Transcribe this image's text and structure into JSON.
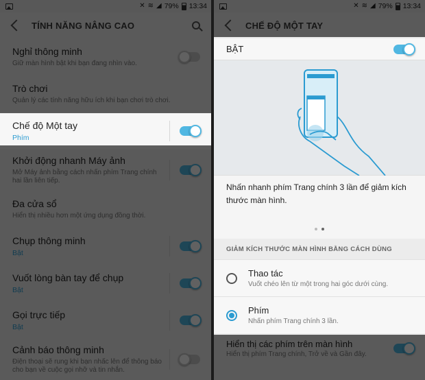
{
  "status": {
    "battery": "79%",
    "time": "13:34"
  },
  "left": {
    "title": "TÍNH NĂNG NÂNG CAO",
    "settings": [
      {
        "title": "Nghỉ thông minh",
        "sub": "Giữ màn hình bật khi bạn đang nhìn vào.",
        "on": false
      },
      {
        "title": "Trò chơi",
        "sub": "Quản lý các tính năng hữu ích khi bạn chơi trò chơi."
      },
      {
        "title": "Chế độ Một tay",
        "sub": "Phím",
        "on": true,
        "highlighted": true
      },
      {
        "title": "Khởi động nhanh Máy ảnh",
        "sub": "Mở Máy ảnh bằng cách nhấn phím Trang chính hai lần liên tiếp.",
        "on": true
      },
      {
        "title": "Đa cửa sổ",
        "sub": "Hiển thị nhiều hơn một ứng dụng đồng thời."
      },
      {
        "title": "Chụp thông minh",
        "sub": "Bật",
        "on": true
      },
      {
        "title": "Vuốt lòng bàn tay để chụp",
        "sub": "Bật",
        "on": true
      },
      {
        "title": "Gọi trực tiếp",
        "sub": "Bật",
        "on": true
      },
      {
        "title": "Cảnh báo thông minh",
        "sub": "Điện thoại sẽ rung khi bạn nhấc lên để thông báo cho bạn về cuộc gọi nhỡ và tin nhắn.",
        "on": false
      }
    ]
  },
  "right": {
    "title": "CHẾ ĐỘ MỘT TAY",
    "master_label": "BẬT",
    "description": "Nhấn nhanh phím Trang chính 3 lần để giảm kích thước màn hình.",
    "section_header": "GIẢM KÍCH THƯỚC MÀN HÌNH BẰNG CÁCH DÙNG",
    "options": [
      {
        "title": "Thao tác",
        "sub": "Vuốt chéo lên từ một trong hai góc dưới cùng.",
        "selected": false
      },
      {
        "title": "Phím",
        "sub": "Nhấn phím Trang chính 3 lần.",
        "selected": true
      }
    ],
    "bottom": {
      "title": "Hiển thị các phím trên màn hình",
      "sub": "Hiển thị phím Trang chính, Trở về và Gần đây.",
      "on": true
    }
  },
  "colors": {
    "accent": "#2b9bd1",
    "toggle_on": "#50b7e2"
  },
  "icons": [
    "gallery-icon",
    "mute-icon",
    "wifi-icon",
    "signal-icon",
    "battery-icon",
    "back-icon",
    "search-icon"
  ]
}
